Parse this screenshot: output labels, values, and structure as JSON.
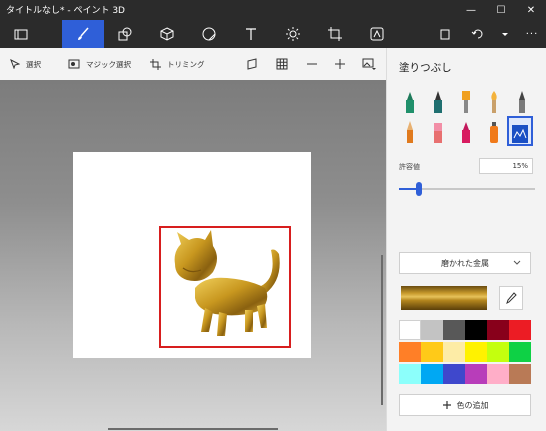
{
  "title": "タイトルなし* - ペイント 3D",
  "toolbar": {
    "tools": [
      "folder-icon",
      "brush-icon",
      "shapes2d-icon",
      "shapes3d-icon",
      "sticker-icon",
      "text-icon",
      "effects-icon",
      "crop-icon",
      "mixed-reality-icon"
    ]
  },
  "subbar": {
    "select_label": "選択",
    "magic_select_label": "マジック選択",
    "crop_label": "トリミング"
  },
  "panel": {
    "heading": "塗りつぶし",
    "tolerance_label": "許容値",
    "tolerance_value": "15%",
    "tolerance_fraction": 0.15,
    "material": "磨かれた金属",
    "add_color_label": "色の追加",
    "palette": [
      "#ffffff",
      "#c3c3c3",
      "#585858",
      "#000000",
      "#88001b",
      "#ec1c24",
      "#ff7f27",
      "#ffca18",
      "#fdeca6",
      "#fff200",
      "#c4ff0e",
      "#0ed145",
      "#8cfffb",
      "#00a8f3",
      "#3f48cc",
      "#b83dba",
      "#ffaec8",
      "#b97a56"
    ]
  },
  "colors": {
    "accent": "#2f5fd8",
    "selection": "#d71e1e",
    "titlebar": "#2b2b2b"
  }
}
